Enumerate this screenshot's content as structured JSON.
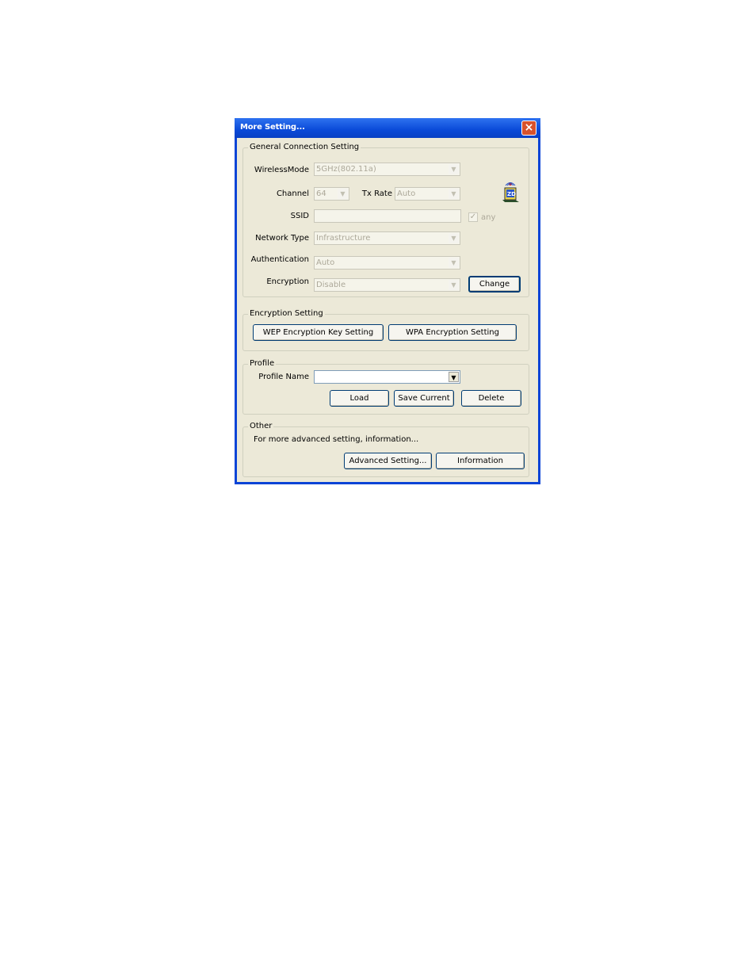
{
  "window": {
    "title": "More Setting...",
    "close_label": "×"
  },
  "general": {
    "legend": "General Connection Setting",
    "wireless_mode_label": "WirelessMode",
    "wireless_mode_value": "5GHz(802.11a)",
    "channel_label": "Channel",
    "channel_value": "64",
    "tx_rate_label": "Tx Rate",
    "tx_rate_value": "Auto",
    "ssid_label": "SSID",
    "ssid_value": "",
    "any_label": "any",
    "any_checked": true,
    "network_type_label": "Network Type",
    "network_type_value": "Infrastructure",
    "authentication_label": "Authentication",
    "authentication_value": "Auto",
    "encryption_label": "Encryption",
    "encryption_value": "Disable",
    "change_button": "Change"
  },
  "encryption_setting": {
    "legend": "Encryption Setting",
    "wep_button": "WEP Encryption Key Setting",
    "wpa_button": "WPA Encryption Setting"
  },
  "profile": {
    "legend": "Profile",
    "name_label": "Profile Name",
    "name_value": "",
    "load_button": "Load",
    "save_button": "Save Current",
    "delete_button": "Delete"
  },
  "other": {
    "legend": "Other",
    "description": "For more advanced setting, information...",
    "advanced_button": "Advanced Setting...",
    "information_button": "Information"
  },
  "icons": {
    "app": "zd-wireless-laptop-icon",
    "close": "close-icon",
    "dropdown": "chevron-down-icon",
    "check": "checkmark-icon"
  },
  "colors": {
    "titlebar": "#0a4ad8",
    "client": "#ece9d8",
    "close": "#d8522c",
    "disabled_text": "#aca899"
  }
}
